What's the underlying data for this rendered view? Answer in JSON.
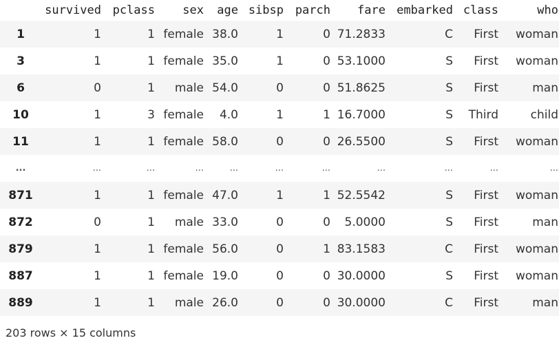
{
  "table": {
    "columns": [
      "",
      "survived",
      "pclass",
      "sex",
      "age",
      "sibsp",
      "parch",
      "fare",
      "embarked",
      "class",
      "who"
    ],
    "rows": [
      [
        "1",
        "1",
        "1",
        "female",
        "38.0",
        "1",
        "0",
        "71.2833",
        "C",
        "First",
        "woman"
      ],
      [
        "3",
        "1",
        "1",
        "female",
        "35.0",
        "1",
        "0",
        "53.1000",
        "S",
        "First",
        "woman"
      ],
      [
        "6",
        "0",
        "1",
        "male",
        "54.0",
        "0",
        "0",
        "51.8625",
        "S",
        "First",
        "man"
      ],
      [
        "10",
        "1",
        "3",
        "female",
        "4.0",
        "1",
        "1",
        "16.7000",
        "S",
        "Third",
        "child"
      ],
      [
        "11",
        "1",
        "1",
        "female",
        "58.0",
        "0",
        "0",
        "26.5500",
        "S",
        "First",
        "woman"
      ],
      [
        "...",
        "...",
        "...",
        "...",
        "...",
        "...",
        "...",
        "...",
        "...",
        "...",
        "..."
      ],
      [
        "871",
        "1",
        "1",
        "female",
        "47.0",
        "1",
        "1",
        "52.5542",
        "S",
        "First",
        "woman"
      ],
      [
        "872",
        "0",
        "1",
        "male",
        "33.0",
        "0",
        "0",
        "5.0000",
        "S",
        "First",
        "man"
      ],
      [
        "879",
        "1",
        "1",
        "female",
        "56.0",
        "0",
        "1",
        "83.1583",
        "C",
        "First",
        "woman"
      ],
      [
        "887",
        "1",
        "1",
        "female",
        "19.0",
        "0",
        "0",
        "30.0000",
        "S",
        "First",
        "woman"
      ],
      [
        "889",
        "1",
        "1",
        "male",
        "26.0",
        "0",
        "0",
        "30.0000",
        "C",
        "First",
        "man"
      ]
    ]
  },
  "footer": {
    "shape_text": "203 rows × 15 columns"
  }
}
